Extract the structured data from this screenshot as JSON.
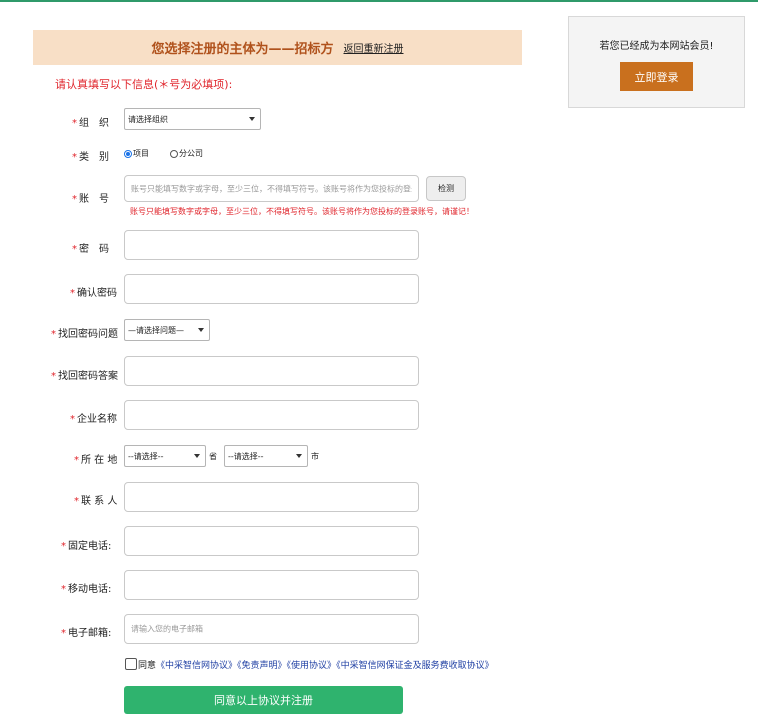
{
  "banner": {
    "title": "您选择注册的主体为——招标方",
    "back_link": "返回重新注册"
  },
  "notice": "请认真填写以下信息(＊号为必填项):",
  "side": {
    "text": "若您已经成为本网站会员!",
    "login_button": "立即登录"
  },
  "form": {
    "organization": {
      "label": "组　织",
      "selected": "请选择组织"
    },
    "category": {
      "label": "类　别",
      "options": [
        "项目",
        "分公司"
      ],
      "selected": "项目"
    },
    "account": {
      "label": "账　号",
      "placeholder": "账号只能填写数字或字母，至少三位，不得填写符号。该账号将作为您投标的登录账号，请谨记！",
      "check_button": "检测",
      "hint": "账号只能填写数字或字母，至少三位，不得填写符号。该账号将作为您投标的登录账号，请谨记！"
    },
    "password": {
      "label": "密　码"
    },
    "confirm_password": {
      "label": "确认密码"
    },
    "security_question": {
      "label": "找回密码问题",
      "selected": "—请选择问题—"
    },
    "security_answer": {
      "label": "找回密码答案"
    },
    "company_name": {
      "label": "企业名称"
    },
    "location": {
      "label": "所 在 地",
      "province_selected": "--请选择--",
      "province_unit": "省",
      "city_selected": "--请选择--",
      "city_unit": "市"
    },
    "contact": {
      "label": "联 系 人"
    },
    "landline": {
      "label": "固定电话:"
    },
    "mobile": {
      "label": "移动电话:"
    },
    "email": {
      "label": "电子邮箱:",
      "placeholder": "请输入您的电子邮箱"
    },
    "agreement": {
      "prefix": "同意",
      "links": [
        "《中采智信网协议》",
        "《免责声明》",
        "《使用协议》",
        "《中采智信网保证金及服务费收取协议》"
      ]
    },
    "submit_label": "同意以上协议并注册"
  }
}
